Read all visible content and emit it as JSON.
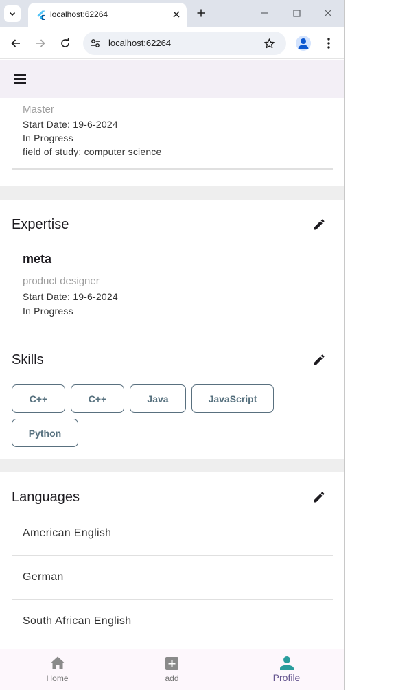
{
  "browser": {
    "tab_title": "localhost:62264",
    "url": "localhost:62264"
  },
  "education": {
    "degree": "Master",
    "start_date": "Start Date: 19-6-2024",
    "status": "In Progress",
    "field": "field of study: computer science"
  },
  "expertise": {
    "title": "Expertise",
    "item": {
      "company": "meta",
      "role": "product designer",
      "start_date": "Start Date: 19-6-2024",
      "status": "In Progress"
    }
  },
  "skills": {
    "title": "Skills",
    "items": [
      "C++",
      "C++",
      "Java",
      "JavaScript",
      "Python"
    ]
  },
  "languages": {
    "title": "Languages",
    "items": [
      "American English",
      "German",
      "South African English"
    ]
  },
  "bottom_nav": {
    "items": [
      {
        "label": "Home",
        "icon": "home-icon"
      },
      {
        "label": "add",
        "icon": "add-box-icon"
      },
      {
        "label": "Profile",
        "icon": "person-icon"
      }
    ],
    "active": "Profile"
  },
  "colors": {
    "accent": "#2a9d9d",
    "active_label": "#65558f",
    "chip_border": "#59707f",
    "appbar_bg": "#f3eff6"
  }
}
